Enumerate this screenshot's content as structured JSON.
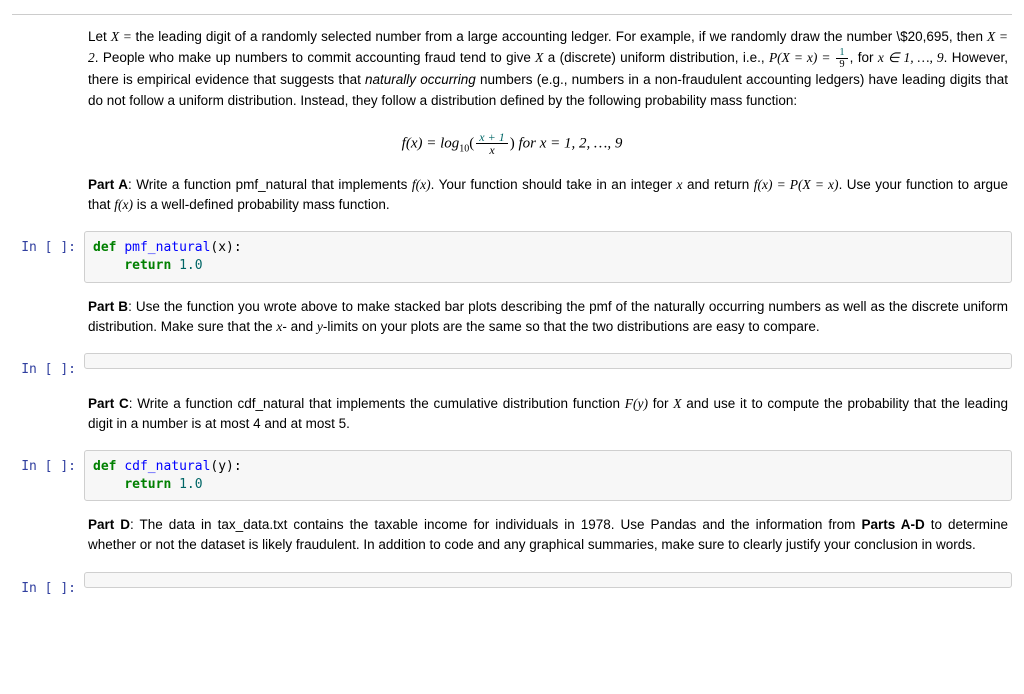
{
  "intro": {
    "p1a": "Let ",
    "p1_eq1": "X = ",
    "p1b": " the leading digit of a randomly selected number from a large accounting ledger. For example, if we randomly draw the number \\$20,695, then ",
    "p1_eq2": "X = 2",
    "p1c": ". People who make up numbers to commit accounting fraud tend to give ",
    "p1_var": "X",
    "p1d": " a (discrete) uniform distribution, i.e., ",
    "p1_eq3a": "P(X = x) = ",
    "p1_eq3_num": "1",
    "p1_eq3_den": "9",
    "p1e": ", for ",
    "p1_eq4": "x ∈ 1, …, 9",
    "p1f": ". However, there is empirical evidence that suggests that ",
    "p1_em": "naturally occurring",
    "p1g": " numbers (e.g., numbers in a non-fraudulent accounting ledgers) have leading digits that do not follow a uniform distribution. Instead, they follow a distribution defined by the following probability mass function:"
  },
  "formula": {
    "lhs": "f(x) = log",
    "sub": "10",
    "lparen": "(",
    "num": "x + 1",
    "den": "x",
    "rparen": ")",
    "for": "   for x = 1, 2, …, 9"
  },
  "partA": {
    "label": "Part A",
    "t1": ": Write a function pmf_natural that implements ",
    "e1": "f(x)",
    "t2": ". Your function should take in an integer ",
    "e2": "x",
    "t3": " and return ",
    "e3": "f(x) = P(X = x)",
    "t4": ". Use your function to argue that ",
    "e4": "f(x)",
    "t5": " is a well-defined probability mass function."
  },
  "partB": {
    "label": "Part B",
    "t1": ": Use the function you wrote above to make stacked bar plots describing the pmf of the naturally occurring numbers as well as the discrete uniform distribution. Make sure that the ",
    "e1": "x",
    "t2": "- and ",
    "e2": "y",
    "t3": "-limits on your plots are the same so that the two distributions are easy to compare."
  },
  "partC": {
    "label": "Part C",
    "t1": ": Write a function cdf_natural that implements the cumulative distribution function ",
    "e1": "F(y)",
    "t2": " for ",
    "e2": "X",
    "t3": " and use it to compute the probability that the leading digit in a number is at most 4 and at most 5."
  },
  "partD": {
    "label": "Part D",
    "t1": ": The data in tax_data.txt contains the taxable income for individuals in 1978. Use Pandas and the information from ",
    "b1": "Parts A-D",
    "t2": " to determine whether or not the dataset is likely fraudulent. In addition to code and any graphical summaries, make sure to clearly justify your conclusion in words."
  },
  "prompt_label": "In [ ]:",
  "code1": {
    "kw_def": "def",
    "fn": "pmf_natural",
    "args": "(x):",
    "indent": "    ",
    "kw_ret": "return",
    "val": " 1.0"
  },
  "code3": {
    "kw_def": "def",
    "fn": "cdf_natural",
    "args": "(y):",
    "indent": "    ",
    "kw_ret": "return",
    "val": " 1.0"
  }
}
